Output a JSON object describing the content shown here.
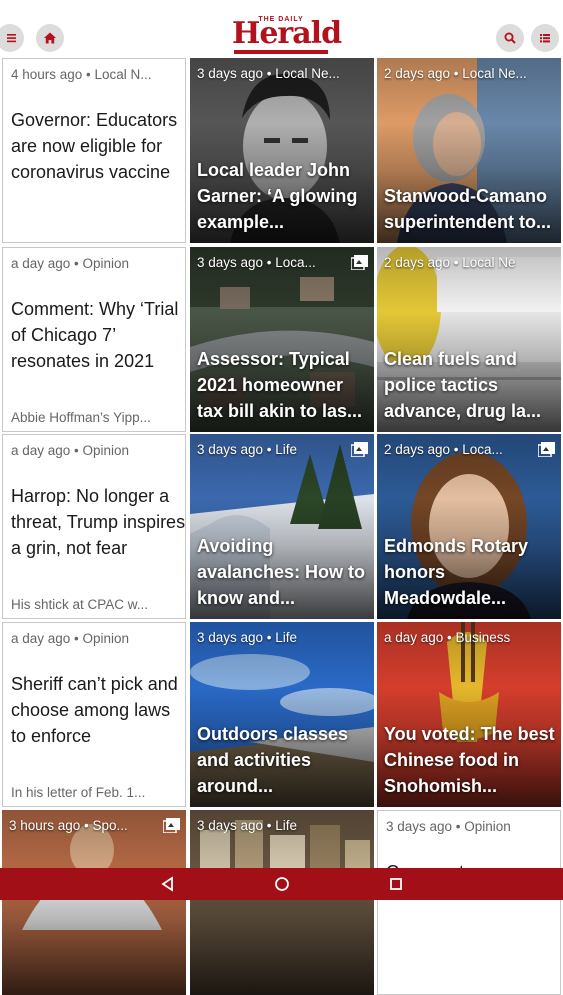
{
  "app": {
    "logo_small": "THE DAILY",
    "logo_text": "Herald",
    "brand_color": "#b3121d",
    "navbar_color": "#a30f16"
  },
  "toolbar": {
    "left_icons": [
      "menu-icon",
      "home-icon"
    ],
    "right_icons": [
      "search-icon",
      "list-icon"
    ]
  },
  "articles": [
    {
      "meta": "4 hours ago • Local N...",
      "headline": "Governor: Educators are now eligible for coronavirus vaccine",
      "excerpt": ""
    },
    {
      "meta": "3 days ago • Local Ne...",
      "headline": "Local leader John Garner: ‘A glowing example...",
      "image": "portrait-bw"
    },
    {
      "meta": "2 days ago • Local Ne...",
      "headline": "Stanwood-Camano superintendent to...",
      "image": "woman-speaking"
    },
    {
      "meta": "a day ago • Opinion",
      "headline": "Comment: Why ‘Trial of Chicago 7’ resonates in 2021",
      "excerpt": "Abbie Hoffman’s Yipp..."
    },
    {
      "meta": "3 days ago • Loca...",
      "headline": "Assessor: Typical 2021 homeowner tax bill akin to las...",
      "image": "aerial-homes",
      "gallery": true
    },
    {
      "meta": "2 days ago • Local Ne",
      "headline": "Clean fuels and police tactics advance, drug la...",
      "image": "corn-sign"
    },
    {
      "meta": "a day ago • Opinion",
      "headline": "Harrop: No longer a threat, Trump inspires a grin, not fear",
      "excerpt": "His shtick at CPAC w..."
    },
    {
      "meta": "3 days ago • Life",
      "headline": "Avoiding avalanches: How to know and...",
      "image": "snowy-trees",
      "gallery": true
    },
    {
      "meta": "2 days ago • Loca...",
      "headline": "Edmonds Rotary honors Meadowdale...",
      "image": "student-portrait",
      "gallery": true
    },
    {
      "meta": "a day ago • Opinion",
      "headline": "Sheriff can’t pick and choose among laws to enforce",
      "excerpt": "In his letter of Feb. 1..."
    },
    {
      "meta": "3 days ago • Life",
      "headline": "Outdoors classes and activities around...",
      "image": "blue-sky"
    },
    {
      "meta": "a day ago • Business",
      "headline": "You voted: The best Chinese food in Snohomish...",
      "image": "noodles-red"
    },
    {
      "meta": "3 hours ago • Spo...",
      "headline": "",
      "image": "athlete",
      "gallery": true
    },
    {
      "meta": "3 days ago • Life",
      "headline": "",
      "image": "books"
    },
    {
      "meta": "3 days ago • Opinion",
      "headline": "Comment:",
      "excerpt": ""
    }
  ],
  "system_nav": {
    "icons": [
      "back-icon",
      "home-circle-icon",
      "recents-icon"
    ]
  }
}
